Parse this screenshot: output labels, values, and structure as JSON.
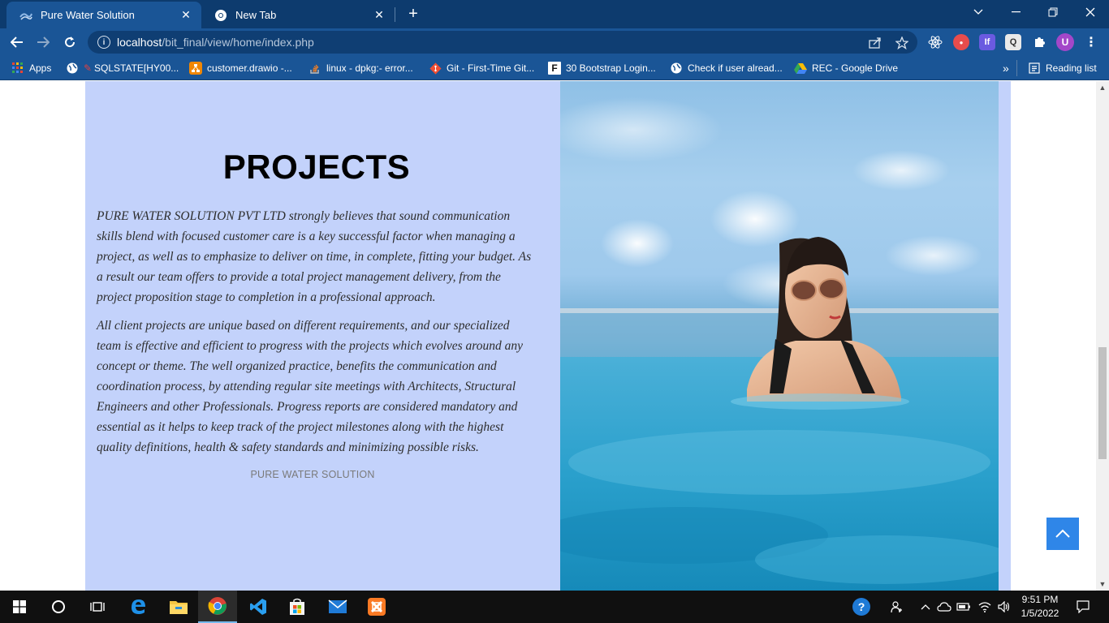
{
  "browser": {
    "tabs": [
      {
        "title": "Pure Water Solution",
        "active": true
      },
      {
        "title": "New Tab",
        "active": false
      }
    ],
    "url_host": "localhost",
    "url_path": "/bit_final/view/home/index.php",
    "bookmarks": [
      {
        "label": "Apps",
        "icon": "apps-grid-icon"
      },
      {
        "label": "SQLSTATE[HY00...",
        "icon": "globe-icon"
      },
      {
        "label": "customer.drawio -...",
        "icon": "drawio-icon"
      },
      {
        "label": "linux - dpkg:- error...",
        "icon": "stackoverflow-icon"
      },
      {
        "label": "Git - First-Time Git...",
        "icon": "git-icon"
      },
      {
        "label": "30 Bootstrap Login...",
        "icon": "f-logo-icon"
      },
      {
        "label": "Check if user alread...",
        "icon": "globe-icon"
      },
      {
        "label": "REC - Google Drive",
        "icon": "google-drive-icon"
      }
    ],
    "reading_list": "Reading list",
    "profile_initial": "U"
  },
  "content": {
    "heading": "PROJECTS",
    "paragraph_1": "PURE WATER SOLUTION PVT LTD strongly believes that sound communication skills blend with focused customer care is a key successful factor when managing a project, as well as to emphasize to deliver on time, in complete, fitting your budget. As a result our team offers to provide a total project management delivery, from the project proposition stage to completion in a professional approach.",
    "paragraph_2": "All client projects are unique based on different requirements, and our specialized team is effective and efficient to progress with the projects which evolves around any concept or theme. The well organized practice, benefits the communication and coordination process, by attending regular site meetings with Architects, Structural Engineers and other Professionals. Progress reports are considered mandatory and essential as it helps to keep track of the project milestones along with the highest quality definitions, health & safety standards and minimizing possible risks.",
    "company_name": "PURE WATER SOLUTION"
  },
  "colors": {
    "panel_bg": "#c3d2fb",
    "back_to_top": "#2f86e8",
    "chrome_frame": "#0d3b6e",
    "chrome_toolbar": "#1a5596"
  },
  "taskbar": {
    "time": "9:51 PM",
    "date": "1/5/2022"
  }
}
